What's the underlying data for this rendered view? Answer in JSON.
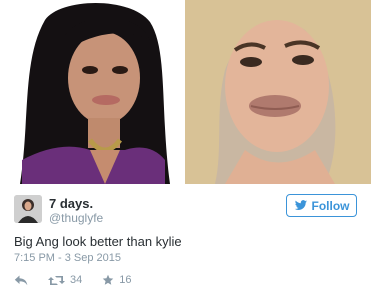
{
  "photos": {
    "left_alt": "",
    "right_alt": ""
  },
  "tweet": {
    "display_name": "7 days.",
    "handle": "@thuglyfe",
    "follow_label": "Follow",
    "text": "Big Ang look better than kylie",
    "timestamp": "7:15 PM - 3 Sep 2015",
    "retweet_count": "34",
    "like_count": "16"
  },
  "icons": {
    "reply": "reply-icon",
    "retweet": "retweet-icon",
    "like": "star-icon",
    "follow": "twitter-bird-icon"
  },
  "colors": {
    "accent": "#3b94d9",
    "muted": "#8899a6",
    "text": "#292f33"
  }
}
